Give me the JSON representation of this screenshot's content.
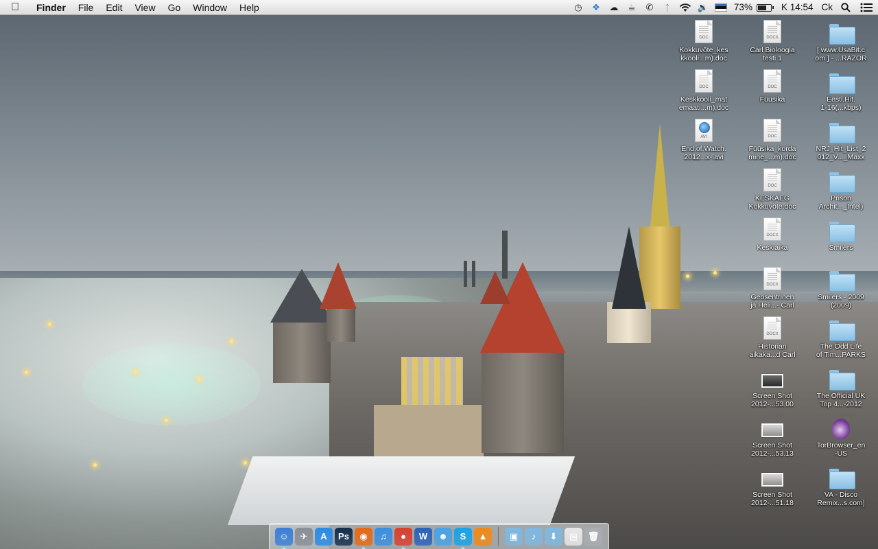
{
  "menubar": {
    "app_name": "Finder",
    "menus": [
      "File",
      "Edit",
      "View",
      "Go",
      "Window",
      "Help"
    ],
    "battery_percent": "73%",
    "battery_level": 0.73,
    "clock": "K 14:54",
    "user": "Ck",
    "status_icons": [
      "time-machine-icon",
      "dropbox-icon",
      "cloud-icon",
      "cup-icon",
      "phone-icon",
      "bluetooth-icon",
      "wifi-icon",
      "volume-icon",
      "estonian-flag-icon",
      "battery-icon",
      "spotlight-icon",
      "notification-list-icon"
    ]
  },
  "desktop": {
    "items": [
      {
        "label": "Kokkuvõte_kes\nkkooli...m).doc",
        "type": "doc",
        "badge": "DOC"
      },
      {
        "label": "Carl Bioloogia\ntesti 1",
        "type": "doc",
        "badge": "DOCX"
      },
      {
        "label": "[ www.UsaBit.c\nom ] - ...RAZOR",
        "type": "folder"
      },
      {
        "label": "Keskkooli_mat\nemaati...m).doc",
        "type": "doc",
        "badge": "DOC"
      },
      {
        "label": "Füüsika",
        "type": "doc",
        "badge": "DOC"
      },
      {
        "label": "Eesti.Hit.\n1-16(...kbps)",
        "type": "folder"
      },
      {
        "label": "End.of.Watch.\n2012...x-.avi",
        "type": "avi",
        "badge": "AVI"
      },
      {
        "label": "Füüsika_korda\nmine_...m).doc",
        "type": "doc",
        "badge": "DOC"
      },
      {
        "label": "NRJ_Hit_List_2\n012_V..._Maxx",
        "type": "folder"
      },
      {
        "label": "KESKAEG\nKokkuvõte.doc",
        "type": "doc",
        "badge": "DOC"
      },
      {
        "label": "Prison\nArchit..._Intel)",
        "type": "folder"
      },
      {
        "label": "Keskiaika",
        "type": "doc",
        "badge": "DOCX"
      },
      {
        "label": "Smilers",
        "type": "folder"
      },
      {
        "label": "Geosentrinen\nja Heli...- Carl",
        "type": "doc",
        "badge": "DOCX"
      },
      {
        "label": "Smilers - 2009\n(2009)",
        "type": "folder"
      },
      {
        "label": "Historian\naikaka...d Carl",
        "type": "doc",
        "badge": "DOCX"
      },
      {
        "label": "The Odd Life\nof Tim...PARKS",
        "type": "folder"
      },
      {
        "label": "Screen Shot\n2012-...53.00",
        "type": "shot"
      },
      {
        "label": "The Official UK\nTop 4...-2012",
        "type": "folder"
      },
      {
        "label": "Screen Shot\n2012-...53.13",
        "type": "shot-light"
      },
      {
        "label": "TorBrowser_en\n-US",
        "type": "onion"
      },
      {
        "label": "Screen Shot\n2012-...51.18",
        "type": "shot-light"
      },
      {
        "label": "VA - Disco\nRemix...s.com]",
        "type": "folder"
      }
    ]
  },
  "dock": {
    "apps": [
      {
        "name": "finder-icon",
        "glyph": "☺",
        "color": "#3a7fd6",
        "running": true
      },
      {
        "name": "launchpad-icon",
        "glyph": "✈",
        "color": "#8a8f95",
        "running": false
      },
      {
        "name": "app-store-icon",
        "glyph": "A",
        "color": "#2a8be6",
        "running": false
      },
      {
        "name": "photoshop-icon",
        "glyph": "Ps",
        "color": "#132f4d",
        "running": false
      },
      {
        "name": "firefox-icon",
        "glyph": "◉",
        "color": "#e66a1a",
        "running": true
      },
      {
        "name": "itunes-icon",
        "glyph": "♫",
        "color": "#3b8fe0",
        "running": false
      },
      {
        "name": "chrome-icon",
        "glyph": "●",
        "color": "#d9402f",
        "running": true
      },
      {
        "name": "word-icon",
        "glyph": "W",
        "color": "#2a63b8",
        "running": false
      },
      {
        "name": "messenger-icon",
        "glyph": "☻",
        "color": "#4aa3e6",
        "running": false
      },
      {
        "name": "skype-icon",
        "glyph": "S",
        "color": "#19a3e6",
        "running": true
      },
      {
        "name": "vlc-icon",
        "glyph": "▲",
        "color": "#f08a1a",
        "running": false
      }
    ],
    "stacks": [
      {
        "name": "applications-folder-icon",
        "glyph": "▣",
        "color": "#7fb8e0"
      },
      {
        "name": "music-folder-icon",
        "glyph": "♪",
        "color": "#7fb8e0"
      },
      {
        "name": "downloads-folder-icon",
        "glyph": "⬇",
        "color": "#7fb8e0"
      },
      {
        "name": "documents-stack-icon",
        "glyph": "▤",
        "color": "#e8e8e8"
      },
      {
        "name": "trash-icon",
        "glyph": "🗑",
        "color": "#a9adb1"
      }
    ]
  }
}
